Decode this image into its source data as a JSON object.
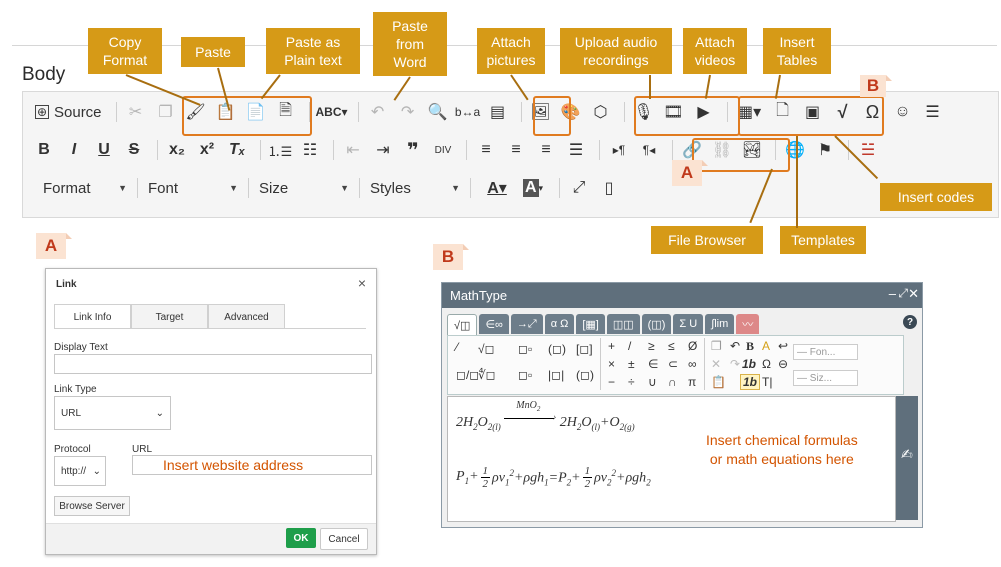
{
  "editor": {
    "body_label": "Body",
    "source_label": "Source",
    "combos": [
      {
        "label": "Format"
      },
      {
        "label": "Font"
      },
      {
        "label": "Size"
      },
      {
        "label": "Styles"
      }
    ],
    "heading_label": "¶"
  },
  "callouts": {
    "copy_format": "Copy\nFormat",
    "paste": "Paste",
    "paste_plain": "Paste as\nPlain text",
    "paste_word": "Paste\nfrom\nWord",
    "attach_pictures": "Attach\npictures",
    "upload_audio": "Upload audio\nrecordings",
    "attach_videos": "Attach\nvideos",
    "insert_tables": "Insert\nTables",
    "insert_codes": "Insert codes",
    "file_browser": "File Browser",
    "templates": "Templates"
  },
  "tags": {
    "a": "A",
    "b": "B"
  },
  "link_dialog": {
    "title": "Link",
    "close": "×",
    "tabs": [
      "Link Info",
      "Target",
      "Advanced"
    ],
    "display_text_label": "Display Text",
    "link_type_label": "Link Type",
    "link_type_value": "URL",
    "protocol_label": "Protocol",
    "protocol_value": "http://",
    "url_label": "URL",
    "url_hint": "Insert website address",
    "browse_button": "Browse Server",
    "ok_button": "OK",
    "cancel_button": "Cancel"
  },
  "mathtype": {
    "title": "MathType",
    "tabs": [
      "√◫",
      "∈∞",
      "→⤢",
      "α Ω",
      "[▦]",
      "◫◫",
      "(◫)",
      "Σ U",
      "∫lim",
      "〰"
    ],
    "font_placeholder": "— Fon...",
    "size_placeholder": "— Siz...",
    "help": "?",
    "hint": "Insert chemical formulas\nor math equations here"
  },
  "colors": {
    "callout_bg": "#d69a17",
    "highlight": "#e07b20",
    "ok_green": "#1e9e4a",
    "hint_orange": "#d35400"
  }
}
